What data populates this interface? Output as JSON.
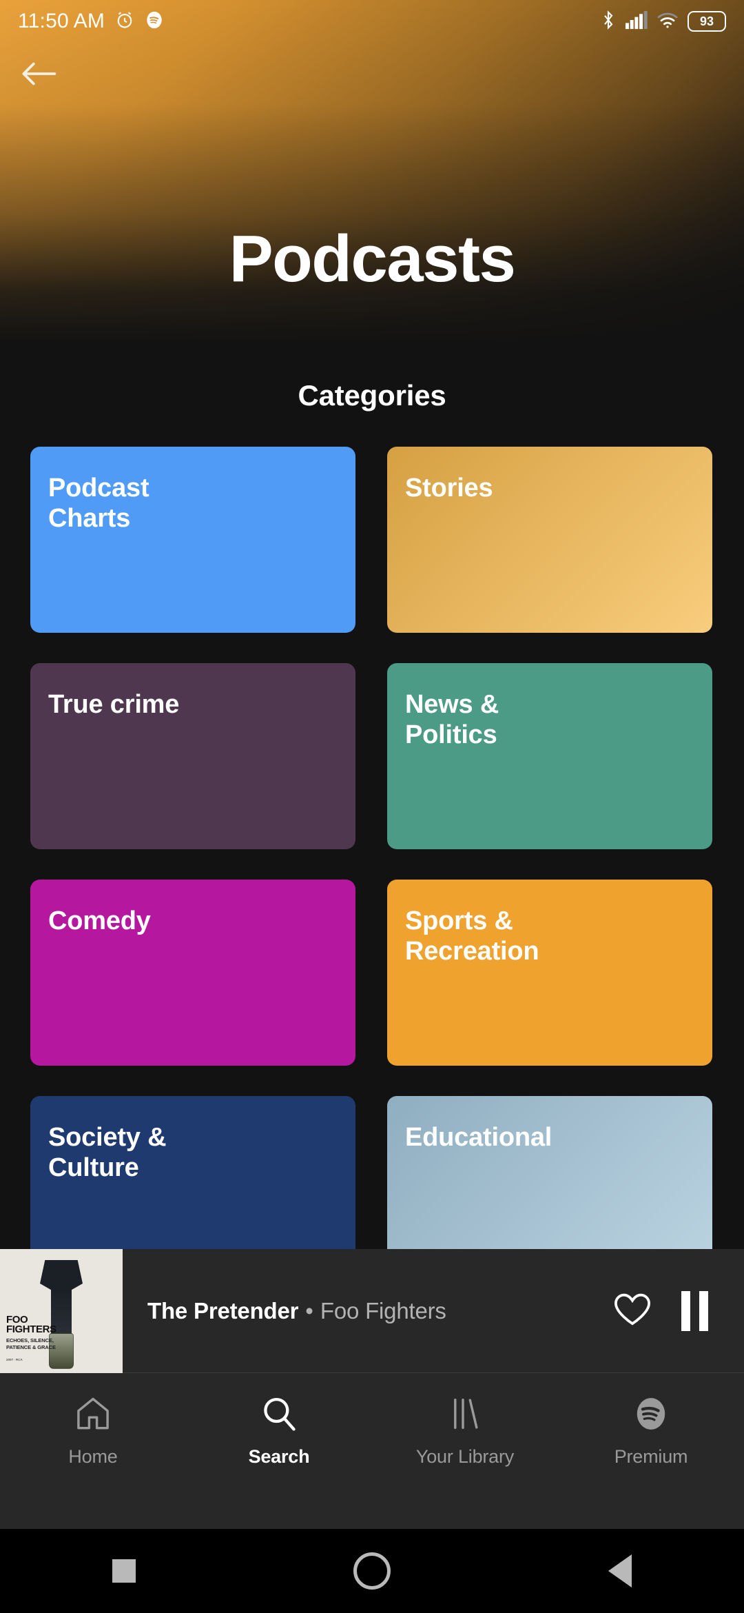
{
  "status_bar": {
    "time": "11:50 AM",
    "alarm_icon": "alarm-clock-icon",
    "app_icon": "spotify-icon",
    "bluetooth_icon": "bluetooth-icon",
    "signal_icon": "cellular-signal-icon",
    "wifi_icon": "wifi-icon",
    "battery_level": "93"
  },
  "header": {
    "back_icon": "back-arrow-icon",
    "title": "Podcasts",
    "accent_color": "#E9A23B"
  },
  "main": {
    "section_heading": "Categories",
    "categories": [
      {
        "label": "Podcast\nCharts",
        "color": "#509BF5",
        "gradient": false
      },
      {
        "label": "Stories",
        "color": "#D6A042",
        "gradient": true,
        "gradient_to": "#F8CD7D"
      },
      {
        "label": "True crime",
        "color": "#503750",
        "gradient": false
      },
      {
        "label": "News &\nPolitics",
        "color": "#4B9B86",
        "gradient": false
      },
      {
        "label": "Comedy",
        "color": "#B5179E",
        "gradient": false
      },
      {
        "label": "Sports &\nRecreation",
        "color": "#F0A22E",
        "gradient": false
      },
      {
        "label": "Society &\nCulture",
        "color": "#1E3A6E",
        "gradient": false
      },
      {
        "label": "Educational",
        "color": "#8FAEC0",
        "gradient": true,
        "gradient_to": "#BCD4E2"
      }
    ]
  },
  "now_playing": {
    "track": "The Pretender",
    "separator": "•",
    "artist": "Foo Fighters",
    "album_art": {
      "artist_line": "FOO\nFIGHTERS",
      "album_line": "ECHOES, SILENCE,\nPATIENCE & GRACE",
      "tiny_line": "2007 · RCA"
    },
    "like_icon": "heart-outline-icon",
    "playback_icon": "pause-icon"
  },
  "bottom_nav": {
    "items": [
      {
        "label": "Home",
        "icon": "home-icon",
        "active": false
      },
      {
        "label": "Search",
        "icon": "search-icon",
        "active": true
      },
      {
        "label": "Your Library",
        "icon": "library-icon",
        "active": false
      },
      {
        "label": "Premium",
        "icon": "spotify-logo-icon",
        "active": false
      }
    ]
  },
  "system_nav": {
    "recents_icon": "square-recents-icon",
    "home_icon": "circle-home-icon",
    "back_icon": "triangle-back-icon"
  }
}
